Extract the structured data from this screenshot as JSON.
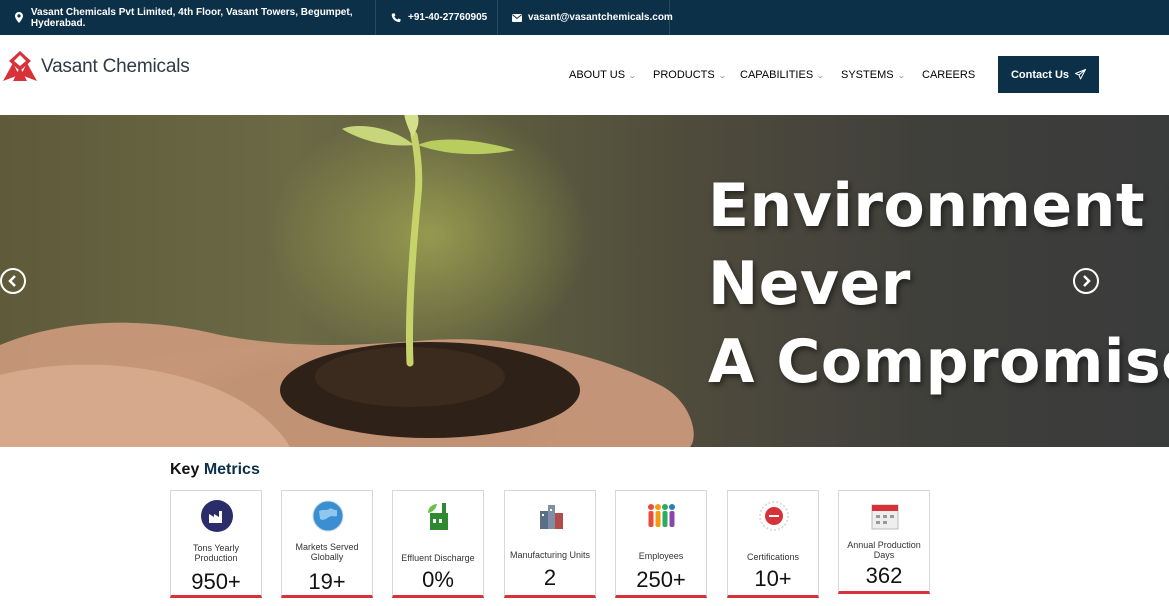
{
  "topbar": {
    "address": "Vasant Chemicals Pvt Limited, 4th Floor, Vasant Towers, Begumpet, Hyderabad.",
    "phone": "+91-40-27760905",
    "email": "vasant@vasantchemicals.com"
  },
  "header": {
    "logo_text": "Vasant Chemicals",
    "nav": [
      {
        "label": "ABOUT US"
      },
      {
        "label": "PRODUCTS"
      },
      {
        "label": "CAPABILITIES"
      },
      {
        "label": "SYSTEMS"
      },
      {
        "label": "CAREERS"
      }
    ],
    "contact_label": "Contact Us"
  },
  "hero": {
    "line1": "Environment is",
    "line2": "Never",
    "line3": "A Compromise"
  },
  "metrics": {
    "heading_part1": "Key",
    "heading_part2": "Metrics",
    "items": [
      {
        "label": "Tons Yearly Production",
        "value": "950+",
        "icon": "factory-icon"
      },
      {
        "label": "Markets Served Globally",
        "value": "19+",
        "icon": "globe-icon"
      },
      {
        "label": "Effluent Discharge",
        "value": "0%",
        "icon": "eco-factory-icon"
      },
      {
        "label": "Manufacturing Units",
        "value": "2",
        "icon": "plant-icon"
      },
      {
        "label": "Employees",
        "value": "250+",
        "icon": "people-icon"
      },
      {
        "label": "Certifications",
        "value": "10+",
        "icon": "certificate-icon"
      },
      {
        "label": "Annual Production Days",
        "value": "362",
        "icon": "calendar-icon"
      }
    ]
  },
  "colors": {
    "navy": "#0d3049",
    "accent_red": "#d9313a"
  }
}
